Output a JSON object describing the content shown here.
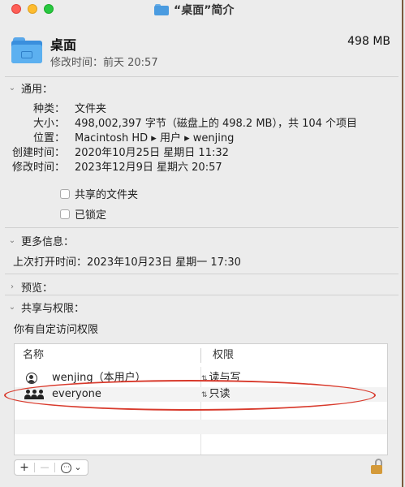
{
  "window": {
    "title": "“桌面”简介"
  },
  "header": {
    "name": "桌面",
    "size": "498 MB",
    "modified": "修改时间：前天 20:57"
  },
  "general": {
    "title": "通用：",
    "rows": [
      {
        "label": "种类：",
        "value": "文件夹"
      },
      {
        "label": "大小：",
        "value": "498,002,397 字节（磁盘上的 498.2 MB），共 104 个项目"
      },
      {
        "label": "位置：",
        "value": "Macintosh HD ▸ 用户 ▸ wenjing"
      },
      {
        "label": "创建时间：",
        "value": "2020年10月25日 星期日 11:32"
      },
      {
        "label": "修改时间：",
        "value": "2023年12月9日 星期六 20:57"
      }
    ],
    "shared_label": "共享的文件夹",
    "locked_label": "已锁定"
  },
  "more": {
    "title": "更多信息：",
    "last_opened": "上次打开时间：2023年10月23日 星期一 17:30"
  },
  "preview": {
    "title": "预览："
  },
  "sharing": {
    "title": "共享与权限：",
    "note": "你有自定访问权限",
    "col_name": "名称",
    "col_perm": "权限",
    "rows": [
      {
        "name": "wenjing（本用户）",
        "perm": "读与写"
      },
      {
        "name": "everyone",
        "perm": "只读"
      }
    ]
  },
  "toolbar": {
    "add": "+",
    "remove": "—",
    "action": "···",
    "chevron": "⌄"
  }
}
